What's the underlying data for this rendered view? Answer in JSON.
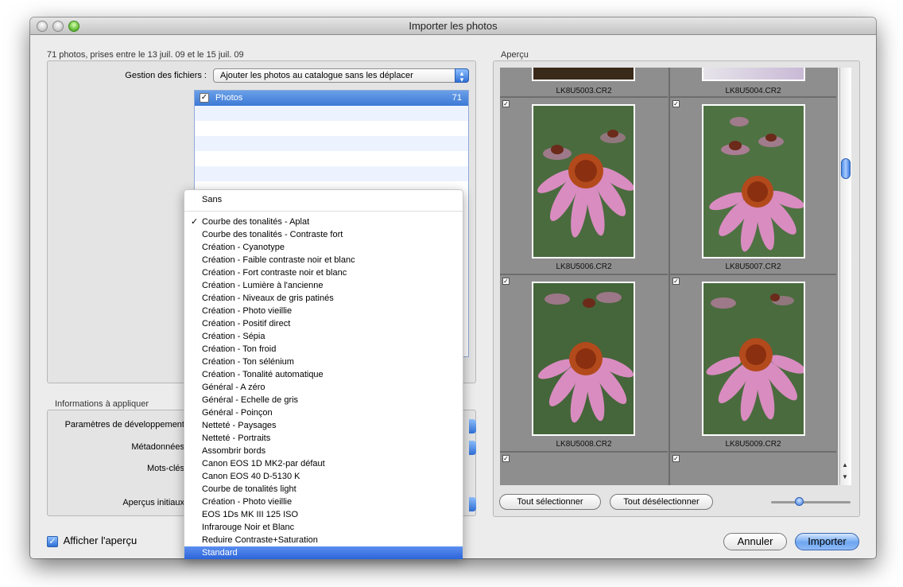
{
  "window": {
    "title": "Importer les photos"
  },
  "summary": "71 photos, prises entre le 13 juil. 09 et le 15 juil. 09",
  "file_management": {
    "label": "Gestion des fichiers :",
    "value": "Ajouter les photos au catalogue sans les déplacer",
    "folders": [
      {
        "name": "Photos",
        "count": "71",
        "checked": true
      }
    ]
  },
  "info": {
    "title": "Informations à appliquer",
    "labels": [
      "Paramètres de développement",
      "Métadonnées",
      "Mots-clés",
      "Aperçus initiaux"
    ]
  },
  "preview": {
    "title": "Aperçu",
    "top_files": [
      "LK8U5003.CR2",
      "LK8U5004.CR2"
    ],
    "rows": [
      [
        "LK8U5006.CR2",
        "LK8U5007.CR2"
      ],
      [
        "LK8U5008.CR2",
        "LK8U5009.CR2"
      ]
    ],
    "select_all": "Tout sélectionner",
    "deselect_all": "Tout désélectionner",
    "check_mark": "✓"
  },
  "show_preview": {
    "label": "Afficher l'aperçu",
    "checked": true
  },
  "buttons": {
    "cancel": "Annuler",
    "import": "Importer"
  },
  "dropdown_menu": {
    "first": "Sans",
    "checked_item": "Courbe des tonalités - Aplat",
    "items": [
      "Courbe des tonalités - Aplat",
      "Courbe des tonalités - Contraste fort",
      "Création - Cyanotype",
      "Création - Faible contraste noir et blanc",
      "Création - Fort contraste noir et blanc",
      "Création - Lumière à l'ancienne",
      "Création - Niveaux de gris patinés",
      "Création - Photo vieillie",
      "Création - Positif direct",
      "Création - Sépia",
      "Création - Ton froid",
      "Création - Ton sélénium",
      "Création - Tonalité automatique",
      "Général - A zéro",
      "Général - Echelle de gris",
      "Général - Poinçon",
      "Netteté - Paysages",
      "Netteté - Portraits",
      "Assombrir bords",
      "Canon EOS 1D MK2-par défaut",
      "Canon EOS 40 D-5130 K",
      "Courbe de tonalités light",
      "Création - Photo vieillie",
      "EOS 1Ds MK III 125 ISO",
      "Infrarouge Noir et Blanc",
      "Reduire Contraste+Saturation",
      "Standard"
    ],
    "highlighted": "Standard"
  },
  "colors": {
    "accent": "#3c79d6",
    "grid_bg": "#8e8e8e"
  }
}
